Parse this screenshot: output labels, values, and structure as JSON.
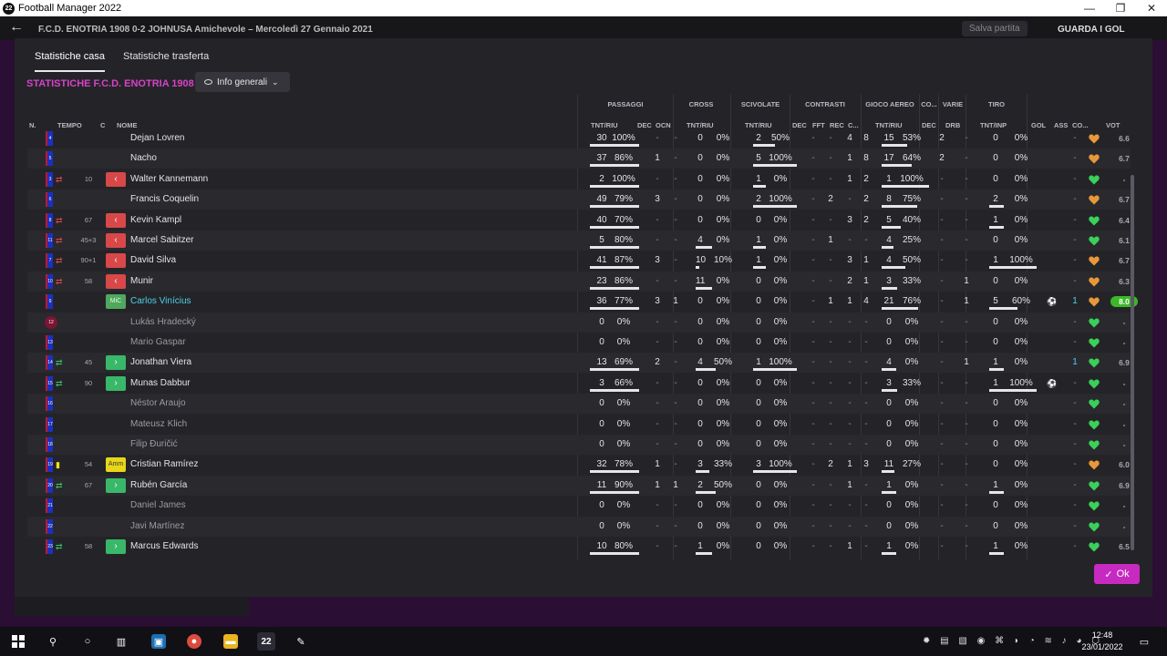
{
  "window": {
    "title": "Football Manager 2022",
    "app_badge": "22",
    "minimize": "—",
    "maximize": "❐",
    "close": "✕"
  },
  "header": {
    "back": "←",
    "match": "F.C.D. ENOTRIA 1908 0-2 JOHNUSA  Amichevole – Mercoledì 27 Gennaio 2021",
    "save": "Salva partita",
    "watch": "GUARDA I GOL"
  },
  "tabs": {
    "home": "Statistiche casa",
    "away": "Statistiche trasferta"
  },
  "team_title": "STATISTICHE F.C.D. ENOTRIA 1908",
  "info_button": "Info generali",
  "groups": {
    "passaggi": "PASSAGGI",
    "cross": "CROSS",
    "scivolate": "SCIVOLATE",
    "contrasti": "CONTRASTI",
    "gioco_aereo": "GIOCO AEREO",
    "co": "CO...",
    "varie": "VARIE",
    "tiro": "TIRO"
  },
  "columns": {
    "n": "N.",
    "tempo": "TEMPO",
    "c": "C",
    "nome": "NOME",
    "pass_tnt": "TNT/RIU",
    "pass_dec": "DEC",
    "pass_ocn": "OCN",
    "cross_tnt": "TNT/RIU",
    "sciv_tnt": "TNT/RIU",
    "con_dec": "DEC",
    "con_fft": "FFT",
    "con_rec": "REC",
    "con_c": "C...",
    "aer_tnt": "TNT/RIU",
    "co_dec": "DEC",
    "var_drb": "DRB",
    "tiro_tnt": "TNT/INP",
    "gol": "GOL",
    "ass": "ASS",
    "cond": "CO...",
    "vot": "VOT"
  },
  "players": [
    {
      "n": "4",
      "name": "Dejan Lovren",
      "p": [
        "30",
        "100%"
      ],
      "pd": "-",
      "po": "-",
      "cr": [
        "0",
        "0%"
      ],
      "sc": [
        "2",
        "50%"
      ],
      "cd": "-",
      "cf": "-",
      "cre": "4",
      "cc": "8",
      "ae": [
        "15",
        "53%"
      ],
      "co": "2",
      "dr": "-",
      "ti": [
        "0",
        "0%"
      ],
      "g": "",
      "a": "-",
      "v": "6.6"
    },
    {
      "n": "5",
      "name": "Nacho",
      "p": [
        "37",
        "86%"
      ],
      "pd": "1",
      "po": "-",
      "cr": [
        "0",
        "0%"
      ],
      "sc": [
        "5",
        "100%"
      ],
      "cd": "-",
      "cf": "-",
      "cre": "1",
      "cc": "8",
      "ae": [
        "17",
        "64%"
      ],
      "co": "2",
      "dr": "-",
      "ti": [
        "0",
        "0%"
      ],
      "g": "",
      "a": "-",
      "v": "6.7"
    },
    {
      "n": "3",
      "name": "Walter Kannemann",
      "tempo": "10",
      "sub": "out",
      "p": [
        "2",
        "100%"
      ],
      "pd": "-",
      "po": "-",
      "cr": [
        "0",
        "0%"
      ],
      "sc": [
        "1",
        "0%"
      ],
      "cd": "-",
      "cf": "-",
      "cre": "1",
      "cc": "2",
      "ae": [
        "1",
        "100%"
      ],
      "co": "-",
      "dr": "-",
      "ti": [
        "0",
        "0%"
      ],
      "g": "",
      "a": "-",
      "v": "-"
    },
    {
      "n": "6",
      "name": "Francis Coquelin",
      "p": [
        "49",
        "79%"
      ],
      "pd": "3",
      "po": "-",
      "cr": [
        "0",
        "0%"
      ],
      "sc": [
        "2",
        "100%"
      ],
      "cd": "-",
      "cf": "2",
      "cre": "-",
      "cc": "2",
      "ae": [
        "8",
        "75%"
      ],
      "co": "-",
      "dr": "-",
      "ti": [
        "2",
        "0%"
      ],
      "g": "",
      "a": "-",
      "v": "6.7"
    },
    {
      "n": "8",
      "name": "Kevin Kampl",
      "tempo": "67",
      "sub": "out",
      "p": [
        "40",
        "70%"
      ],
      "pd": "-",
      "po": "-",
      "cr": [
        "0",
        "0%"
      ],
      "sc": [
        "0",
        "0%"
      ],
      "cd": "-",
      "cf": "-",
      "cre": "3",
      "cc": "2",
      "ae": [
        "5",
        "40%"
      ],
      "co": "-",
      "dr": "-",
      "ti": [
        "1",
        "0%"
      ],
      "g": "",
      "a": "-",
      "v": "6.4"
    },
    {
      "n": "11",
      "name": "Marcel Sabitzer",
      "tempo": "45+3",
      "sub": "out",
      "p": [
        "5",
        "80%"
      ],
      "pd": "-",
      "po": "-",
      "cr": [
        "4",
        "0%"
      ],
      "sc": [
        "1",
        "0%"
      ],
      "cd": "-",
      "cf": "1",
      "cre": "-",
      "cc": "-",
      "ae": [
        "4",
        "25%"
      ],
      "co": "-",
      "dr": "-",
      "ti": [
        "0",
        "0%"
      ],
      "g": "",
      "a": "-",
      "v": "6.1"
    },
    {
      "n": "7",
      "name": "David Silva",
      "tempo": "90+1",
      "sub": "out",
      "p": [
        "41",
        "87%"
      ],
      "pd": "3",
      "po": "-",
      "cr": [
        "10",
        "10%"
      ],
      "sc": [
        "1",
        "0%"
      ],
      "cd": "-",
      "cf": "-",
      "cre": "3",
      "cc": "1",
      "ae": [
        "4",
        "50%"
      ],
      "co": "-",
      "dr": "-",
      "ti": [
        "1",
        "100%"
      ],
      "g": "",
      "a": "-",
      "v": "6.7"
    },
    {
      "n": "10",
      "name": "Munir",
      "tempo": "58",
      "sub": "out",
      "p": [
        "23",
        "86%"
      ],
      "pd": "-",
      "po": "-",
      "cr": [
        "11",
        "0%"
      ],
      "sc": [
        "0",
        "0%"
      ],
      "cd": "-",
      "cf": "-",
      "cre": "2",
      "cc": "1",
      "ae": [
        "3",
        "33%"
      ],
      "co": "-",
      "dr": "1",
      "ti": [
        "0",
        "0%"
      ],
      "g": "",
      "a": "-",
      "v": "6.3"
    },
    {
      "n": "9",
      "name": "Carlos Vinícius",
      "mic": "MiC",
      "p": [
        "36",
        "77%"
      ],
      "pd": "3",
      "po": "1",
      "cr": [
        "0",
        "0%"
      ],
      "sc": [
        "0",
        "0%"
      ],
      "cd": "-",
      "cf": "1",
      "cre": "1",
      "cc": "4",
      "ae": [
        "21",
        "76%"
      ],
      "co": "-",
      "dr": "1",
      "ti": [
        "5",
        "60%"
      ],
      "g": "ball",
      "a": "1",
      "v": "8.0"
    },
    {
      "n": "12",
      "name": "Lukás Hradecký",
      "gk": true,
      "p": [
        "0",
        "0%"
      ],
      "pd": "-",
      "po": "-",
      "cr": [
        "0",
        "0%"
      ],
      "sc": [
        "0",
        "0%"
      ],
      "cd": "-",
      "cf": "-",
      "cre": "-",
      "cc": "-",
      "ae": [
        "0",
        "0%"
      ],
      "co": "-",
      "dr": "-",
      "ti": [
        "0",
        "0%"
      ],
      "g": "",
      "a": "-",
      "v": "-"
    },
    {
      "n": "13",
      "name": "Mario Gaspar",
      "p": [
        "0",
        "0%"
      ],
      "pd": "-",
      "po": "-",
      "cr": [
        "0",
        "0%"
      ],
      "sc": [
        "0",
        "0%"
      ],
      "cd": "-",
      "cf": "-",
      "cre": "-",
      "cc": "-",
      "ae": [
        "0",
        "0%"
      ],
      "co": "-",
      "dr": "-",
      "ti": [
        "0",
        "0%"
      ],
      "g": "",
      "a": "-",
      "v": "-"
    },
    {
      "n": "14",
      "name": "Jonathan Viera",
      "tempo": "45",
      "sub": "in",
      "p": [
        "13",
        "69%"
      ],
      "pd": "2",
      "po": "-",
      "cr": [
        "4",
        "50%"
      ],
      "sc": [
        "1",
        "100%"
      ],
      "cd": "-",
      "cf": "-",
      "cre": "-",
      "cc": "-",
      "ae": [
        "4",
        "0%"
      ],
      "co": "-",
      "dr": "1",
      "ti": [
        "1",
        "0%"
      ],
      "g": "",
      "a": "1",
      "v": "6.9"
    },
    {
      "n": "15",
      "name": "Munas Dabbur",
      "tempo": "90",
      "sub": "in",
      "p": [
        "3",
        "66%"
      ],
      "pd": "-",
      "po": "-",
      "cr": [
        "0",
        "0%"
      ],
      "sc": [
        "0",
        "0%"
      ],
      "cd": "-",
      "cf": "-",
      "cre": "-",
      "cc": "-",
      "ae": [
        "3",
        "33%"
      ],
      "co": "-",
      "dr": "-",
      "ti": [
        "1",
        "100%"
      ],
      "g": "ball",
      "a": "-",
      "v": "-"
    },
    {
      "n": "16",
      "name": "Néstor Araujo",
      "p": [
        "0",
        "0%"
      ],
      "pd": "-",
      "po": "-",
      "cr": [
        "0",
        "0%"
      ],
      "sc": [
        "0",
        "0%"
      ],
      "cd": "-",
      "cf": "-",
      "cre": "-",
      "cc": "-",
      "ae": [
        "0",
        "0%"
      ],
      "co": "-",
      "dr": "-",
      "ti": [
        "0",
        "0%"
      ],
      "g": "",
      "a": "-",
      "v": "-"
    },
    {
      "n": "17",
      "name": "Mateusz Klich",
      "p": [
        "0",
        "0%"
      ],
      "pd": "-",
      "po": "-",
      "cr": [
        "0",
        "0%"
      ],
      "sc": [
        "0",
        "0%"
      ],
      "cd": "-",
      "cf": "-",
      "cre": "-",
      "cc": "-",
      "ae": [
        "0",
        "0%"
      ],
      "co": "-",
      "dr": "-",
      "ti": [
        "0",
        "0%"
      ],
      "g": "",
      "a": "-",
      "v": "-"
    },
    {
      "n": "18",
      "name": "Filip Đuričić",
      "p": [
        "0",
        "0%"
      ],
      "pd": "-",
      "po": "-",
      "cr": [
        "0",
        "0%"
      ],
      "sc": [
        "0",
        "0%"
      ],
      "cd": "-",
      "cf": "-",
      "cre": "-",
      "cc": "-",
      "ae": [
        "0",
        "0%"
      ],
      "co": "-",
      "dr": "-",
      "ti": [
        "0",
        "0%"
      ],
      "g": "",
      "a": "-",
      "v": "-"
    },
    {
      "n": "19",
      "name": "Cristian Ramírez",
      "tempo": "54",
      "sub": "card",
      "amm": "Amm",
      "p": [
        "32",
        "78%"
      ],
      "pd": "1",
      "po": "-",
      "cr": [
        "3",
        "33%"
      ],
      "sc": [
        "3",
        "100%"
      ],
      "cd": "-",
      "cf": "2",
      "cre": "1",
      "cc": "3",
      "ae": [
        "11",
        "27%"
      ],
      "co": "-",
      "dr": "-",
      "ti": [
        "0",
        "0%"
      ],
      "g": "",
      "a": "-",
      "v": "6.0"
    },
    {
      "n": "20",
      "name": "Rubén García",
      "tempo": "67",
      "sub": "in",
      "p": [
        "11",
        "90%"
      ],
      "pd": "1",
      "po": "1",
      "cr": [
        "2",
        "50%"
      ],
      "sc": [
        "0",
        "0%"
      ],
      "cd": "-",
      "cf": "-",
      "cre": "1",
      "cc": "-",
      "ae": [
        "1",
        "0%"
      ],
      "co": "-",
      "dr": "-",
      "ti": [
        "1",
        "0%"
      ],
      "g": "",
      "a": "-",
      "v": "6.9"
    },
    {
      "n": "21",
      "name": "Daniel James",
      "p": [
        "0",
        "0%"
      ],
      "pd": "-",
      "po": "-",
      "cr": [
        "0",
        "0%"
      ],
      "sc": [
        "0",
        "0%"
      ],
      "cd": "-",
      "cf": "-",
      "cre": "-",
      "cc": "-",
      "ae": [
        "0",
        "0%"
      ],
      "co": "-",
      "dr": "-",
      "ti": [
        "0",
        "0%"
      ],
      "g": "",
      "a": "-",
      "v": "-"
    },
    {
      "n": "22",
      "name": "Javi Martínez",
      "p": [
        "0",
        "0%"
      ],
      "pd": "-",
      "po": "-",
      "cr": [
        "0",
        "0%"
      ],
      "sc": [
        "0",
        "0%"
      ],
      "cd": "-",
      "cf": "-",
      "cre": "-",
      "cc": "-",
      "ae": [
        "0",
        "0%"
      ],
      "co": "-",
      "dr": "-",
      "ti": [
        "0",
        "0%"
      ],
      "g": "",
      "a": "-",
      "v": "-"
    },
    {
      "n": "23",
      "name": "Marcus Edwards",
      "tempo": "58",
      "sub": "in",
      "p": [
        "10",
        "80%"
      ],
      "pd": "-",
      "po": "-",
      "cr": [
        "1",
        "0%"
      ],
      "sc": [
        "0",
        "0%"
      ],
      "cd": "-",
      "cf": "-",
      "cre": "1",
      "cc": "-",
      "ae": [
        "1",
        "0%"
      ],
      "co": "-",
      "dr": "-",
      "ti": [
        "1",
        "0%"
      ],
      "g": "",
      "a": "-",
      "v": "6.5"
    }
  ],
  "ok_button": "Ok",
  "taskbar": {
    "time": "12:48",
    "date": "23/01/2022",
    "fm_label": "22"
  },
  "colors": {
    "accent": "#c72ac0",
    "best_vote": "#3cb828",
    "heart_green": "#3ad05a",
    "heart_orange": "#e8983a"
  }
}
